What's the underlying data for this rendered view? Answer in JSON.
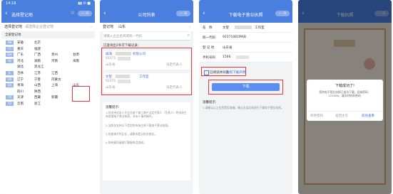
{
  "status": {
    "time": "14:18",
    "right": "▮▮ ✉ ■"
  },
  "s1": {
    "title": "选择登记地",
    "sub_label": "选择登记地",
    "sub_value": "请选择企业登记地",
    "section": "全部登记地",
    "rows": [
      {
        "letter": "AB",
        "items": [
          "安徽",
          "北京"
        ]
      },
      {
        "letter": "CF",
        "items": [
          "重庆",
          "福建"
        ]
      },
      {
        "letter": "GH",
        "items": [
          "广东",
          "广西",
          "贵州",
          "甘肃"
        ]
      },
      {
        "letter": "HJ",
        "items": [
          "河北",
          "湖南",
          "河南",
          "海南"
        ]
      },
      {
        "letter": "",
        "items": [
          "湖北",
          "黑龙江"
        ]
      },
      {
        "letter": "JL",
        "items": [
          "吉林",
          "江苏",
          "江西"
        ]
      },
      {
        "letter": "LN",
        "items": [
          "辽宁",
          "宁夏",
          "内蒙古"
        ]
      },
      {
        "letter": "QS",
        "items": [
          "青海",
          "山西",
          "上海",
          "山东"
        ]
      },
      {
        "letter": "",
        "items": [
          "四川",
          "陕西"
        ]
      },
      {
        "letter": "TX",
        "items": [
          "天津",
          "西藏",
          "新疆"
        ]
      },
      {
        "letter": "YZ",
        "items": [
          "云南",
          "浙江"
        ]
      }
    ]
  },
  "s2": {
    "title": "公司列表",
    "loc_label": "登记地",
    "loc_value": "山东",
    "search_placeholder": "请输入企业名称或统一代码",
    "result_text": "已查询出2条可下载记录：",
    "companies": [
      {
        "name": "威海",
        "name_suffix": "有限公司",
        "code": "91371",
        "region": "山东省",
        "rep": "法定代表人"
      },
      {
        "name": "文登",
        "name_suffix": "工作室",
        "code": "92371",
        "region": "山东省",
        "rep": "法定代表人"
      }
    ],
    "tips_title": "温馨提示:",
    "tips": [
      "1.仅支持对本人为企业或个体工商户法定代表人（负责人）的市场主体发放电子营业执照，非本人请勿操作。",
      "2.当前仅支持以下类型的市场主体下载电子营业执照。",
      "3.如查询不到企业，请联系登记机关核实。",
      "4.如有疑问请拨打客服电话咨询。"
    ]
  },
  "s3": {
    "title": "下载电子营业执照",
    "fields": [
      {
        "label": "名　称",
        "value": "文登",
        "suffix": "工作室"
      },
      {
        "label": "统一代码",
        "value": "92371081MAB"
      },
      {
        "label": "登 记 地",
        "value": "山东省"
      },
      {
        "label": "手机号码",
        "value": "1566"
      }
    ],
    "agree_prefix": "已阅读并同意",
    "agree_link": "执照下载声明",
    "download_label": "下载",
    "tips_title": "温馨提示:",
    "tips": "1.请确认以上信息是否准确，确认无误后再进行下载电子营业执照。"
  },
  "s4": {
    "title": "下载执照",
    "modal_title": "下载成功了!",
    "modal_text": "您的电子营业执照已成功下载，初始密码：123456，请及时修改密码!",
    "btn_change_pw": "修改密码",
    "btn_home": "返回主页",
    "btn_view": "前往查看"
  },
  "capsule": "··· ⊙",
  "colors": {
    "header": "#4a7fe0",
    "highlight": "#e8383d",
    "button": "#5b8ef0"
  }
}
